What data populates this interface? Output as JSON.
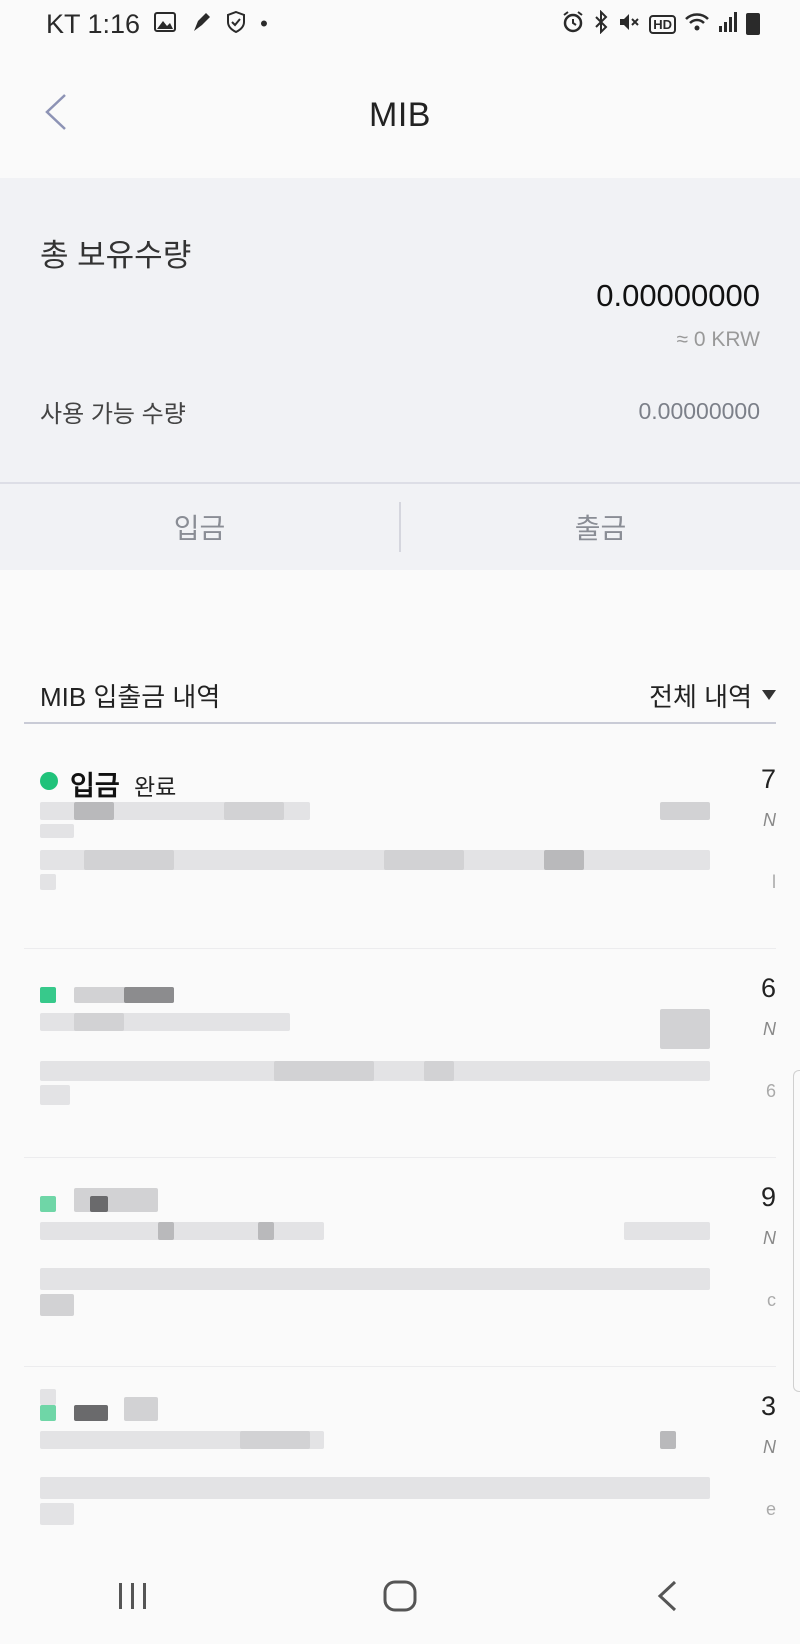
{
  "status_bar": {
    "carrier_time": "KT 1:16",
    "icons_left": [
      "image-icon",
      "pen-icon",
      "shield-icon",
      "dot-icon"
    ],
    "icons_right": [
      "alarm-icon",
      "bluetooth-icon",
      "mute-icon",
      "hd-icon",
      "wifi-icon",
      "signal-icon",
      "battery-icon"
    ],
    "hd_label": "HD"
  },
  "header": {
    "title": "MIB",
    "back_icon": "chevron-left-icon"
  },
  "summary": {
    "total_label": "총 보유수량",
    "total_amount": "0.00000000",
    "krw_approx": "≈ 0 KRW",
    "available_label": "사용 가능 수량",
    "available_value": "0.00000000"
  },
  "actions": {
    "deposit": "입금",
    "withdraw": "출금"
  },
  "history": {
    "title": "MIB 입출금 내역",
    "filter_label": "전체 내역",
    "items": [
      {
        "status_title": "입금",
        "status_sub": "완료",
        "right_digit": "7",
        "right_small": "N",
        "right_small2": "l"
      },
      {
        "status_title": "",
        "status_sub": "",
        "right_digit": "6",
        "right_small": "N",
        "right_small2": "6"
      },
      {
        "status_title": "",
        "status_sub": "",
        "right_digit": "9",
        "right_small": "N",
        "right_small2": "c"
      },
      {
        "status_title": "",
        "status_sub": "",
        "right_digit": "3",
        "right_small": "N",
        "right_small2": "e"
      }
    ]
  },
  "nav_bar": {
    "recents": "recents-icon",
    "home": "home-icon",
    "back": "back-icon"
  },
  "colors": {
    "accent_green": "#20c27a",
    "summary_bg": "#f1f2f5"
  }
}
